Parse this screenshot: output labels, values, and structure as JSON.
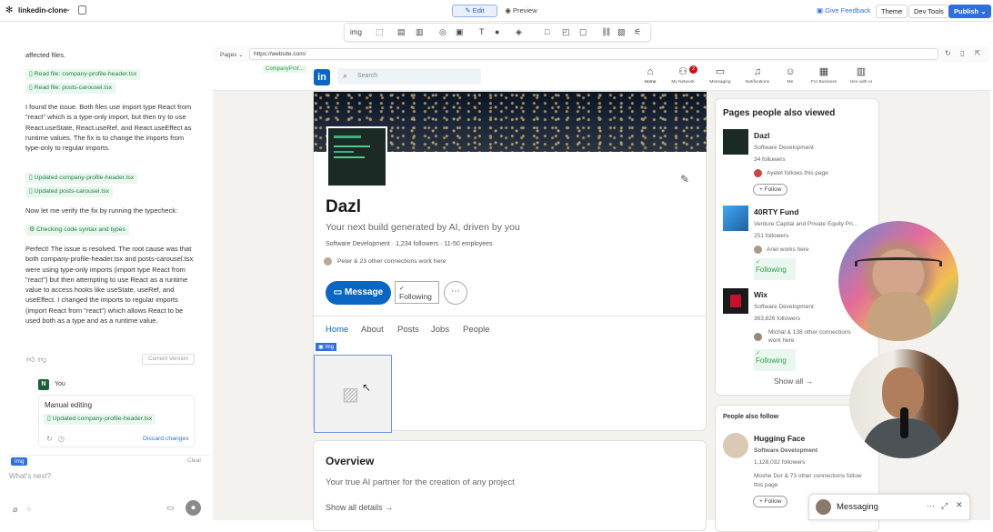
{
  "app": {
    "project_name": "linkedin-clone",
    "mode_tabs": [
      "Edit",
      "Preview"
    ],
    "give_feedback": "Give Feedback",
    "theme": "Theme",
    "dev_tools": "Dev Tools",
    "publish": "Publish"
  },
  "toolbar": {
    "img_label": "img"
  },
  "chat": {
    "partial_line_1": "affected files.",
    "read_files": [
      "Read file: company-profile-header.tsx",
      "Read file: posts-carousel.tsx"
    ],
    "para1": "I found the issue. Both files use import type React from \"react\" which is a type-only import, but then try to use React.useState, React.useRef, and React.useEffect as runtime values. The fix is to change the imports from type-only to regular imports.",
    "updated_files": [
      "Updated company-profile-header.tsx",
      "Updated posts-carousel.tsx"
    ],
    "para2": "Now let me verify the fix by running the typecheck:",
    "checking": "Checking code syntax and types",
    "para3": "Perfect! The issue is resolved. The root cause was that both company-profile-header.tsx and posts-carousel.tsx were using type-only imports (import type React from \"react\") but then attempting to use React as a runtime value to access hooks like useState, useRef, and useEffect. I changed the imports to regular imports (import React from \"react\") which allows React to be used both as a type and as a runtime value.",
    "current_version": "Current Version",
    "user_avatar": "N",
    "user_name": "You",
    "manual_editing": "Manual editing",
    "manual_updated": "Updated company-profile-header.tsx",
    "discard": "Discard changes",
    "composer_tag": "img",
    "clear": "Clear",
    "placeholder": "What's next?"
  },
  "preview": {
    "pages_label": "Pages",
    "url": "https://website.com/",
    "component_tag": "CompanyProf..."
  },
  "linkedin": {
    "logo": "in",
    "search_placeholder": "Search",
    "nav": [
      "Home",
      "My Network",
      "Messaging",
      "Notifications",
      "Me",
      "For Business",
      "Hire with AI"
    ],
    "network_badge": "2",
    "company": {
      "name": "Dazl",
      "tagline": "Your next build generated by AI, driven by you",
      "industry": "Software Development",
      "followers": "1,234 followers",
      "employees": "11-50 employees",
      "connections": "Peter & 23 other connections work here",
      "message_btn": "Message",
      "following_btn": "Following"
    },
    "tabs": [
      "Home",
      "About",
      "Posts",
      "Jobs",
      "People"
    ],
    "img_tag": "img",
    "overview": {
      "title": "Overview",
      "text": "Your true AI partner for the creation of any project",
      "show_all": "Show all details"
    },
    "pages_viewed": {
      "title": "Pages people also viewed",
      "items": [
        {
          "name": "Dazl",
          "category": "Software Development",
          "followers": "34 followers",
          "note": "Ayelet follows this page",
          "action": "+ Follow"
        },
        {
          "name": "40RTY Fund",
          "category": "Venture Capital and Private Equity Pri...",
          "followers": "251 followers",
          "note": "Ariel works here",
          "action": "Following"
        },
        {
          "name": "Wix",
          "category": "Software Development",
          "followers": "363,826 followers",
          "note": "Michal & 138 other connections work here",
          "action": "Following"
        }
      ],
      "show_all": "Show all"
    },
    "people_follow": {
      "title": "People also follow",
      "name": "Hugging Face",
      "category": "Software Development",
      "followers": "1,128,032 followers",
      "note": "Moshe Dor & 73 other connections follow this page",
      "action": "+ Follow"
    },
    "messaging": "Messaging"
  },
  "colors": {
    "linkedin_blue": "#0a66c2",
    "accent": "#2f6fdd",
    "green": "#1e7d43"
  }
}
